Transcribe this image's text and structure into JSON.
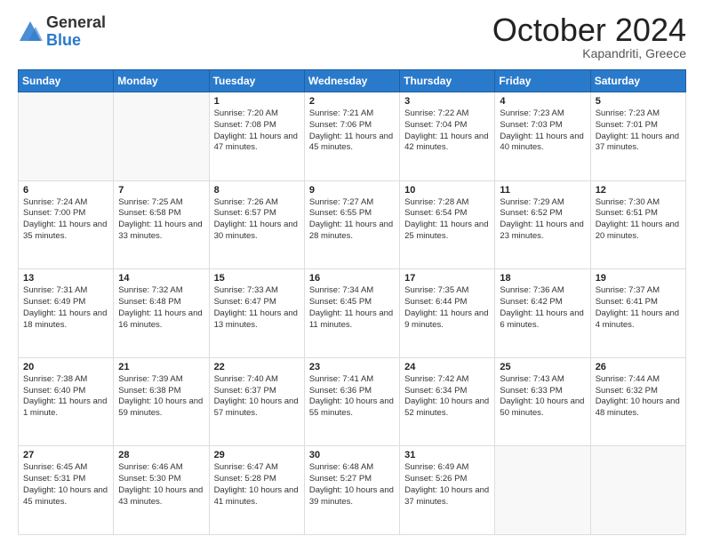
{
  "logo": {
    "general": "General",
    "blue": "Blue"
  },
  "header": {
    "month": "October 2024",
    "location": "Kapandriti, Greece"
  },
  "days_of_week": [
    "Sunday",
    "Monday",
    "Tuesday",
    "Wednesday",
    "Thursday",
    "Friday",
    "Saturday"
  ],
  "weeks": [
    [
      {
        "day": null
      },
      {
        "day": null
      },
      {
        "day": "1",
        "sunrise": "Sunrise: 7:20 AM",
        "sunset": "Sunset: 7:08 PM",
        "daylight": "Daylight: 11 hours and 47 minutes."
      },
      {
        "day": "2",
        "sunrise": "Sunrise: 7:21 AM",
        "sunset": "Sunset: 7:06 PM",
        "daylight": "Daylight: 11 hours and 45 minutes."
      },
      {
        "day": "3",
        "sunrise": "Sunrise: 7:22 AM",
        "sunset": "Sunset: 7:04 PM",
        "daylight": "Daylight: 11 hours and 42 minutes."
      },
      {
        "day": "4",
        "sunrise": "Sunrise: 7:23 AM",
        "sunset": "Sunset: 7:03 PM",
        "daylight": "Daylight: 11 hours and 40 minutes."
      },
      {
        "day": "5",
        "sunrise": "Sunrise: 7:23 AM",
        "sunset": "Sunset: 7:01 PM",
        "daylight": "Daylight: 11 hours and 37 minutes."
      }
    ],
    [
      {
        "day": "6",
        "sunrise": "Sunrise: 7:24 AM",
        "sunset": "Sunset: 7:00 PM",
        "daylight": "Daylight: 11 hours and 35 minutes."
      },
      {
        "day": "7",
        "sunrise": "Sunrise: 7:25 AM",
        "sunset": "Sunset: 6:58 PM",
        "daylight": "Daylight: 11 hours and 33 minutes."
      },
      {
        "day": "8",
        "sunrise": "Sunrise: 7:26 AM",
        "sunset": "Sunset: 6:57 PM",
        "daylight": "Daylight: 11 hours and 30 minutes."
      },
      {
        "day": "9",
        "sunrise": "Sunrise: 7:27 AM",
        "sunset": "Sunset: 6:55 PM",
        "daylight": "Daylight: 11 hours and 28 minutes."
      },
      {
        "day": "10",
        "sunrise": "Sunrise: 7:28 AM",
        "sunset": "Sunset: 6:54 PM",
        "daylight": "Daylight: 11 hours and 25 minutes."
      },
      {
        "day": "11",
        "sunrise": "Sunrise: 7:29 AM",
        "sunset": "Sunset: 6:52 PM",
        "daylight": "Daylight: 11 hours and 23 minutes."
      },
      {
        "day": "12",
        "sunrise": "Sunrise: 7:30 AM",
        "sunset": "Sunset: 6:51 PM",
        "daylight": "Daylight: 11 hours and 20 minutes."
      }
    ],
    [
      {
        "day": "13",
        "sunrise": "Sunrise: 7:31 AM",
        "sunset": "Sunset: 6:49 PM",
        "daylight": "Daylight: 11 hours and 18 minutes."
      },
      {
        "day": "14",
        "sunrise": "Sunrise: 7:32 AM",
        "sunset": "Sunset: 6:48 PM",
        "daylight": "Daylight: 11 hours and 16 minutes."
      },
      {
        "day": "15",
        "sunrise": "Sunrise: 7:33 AM",
        "sunset": "Sunset: 6:47 PM",
        "daylight": "Daylight: 11 hours and 13 minutes."
      },
      {
        "day": "16",
        "sunrise": "Sunrise: 7:34 AM",
        "sunset": "Sunset: 6:45 PM",
        "daylight": "Daylight: 11 hours and 11 minutes."
      },
      {
        "day": "17",
        "sunrise": "Sunrise: 7:35 AM",
        "sunset": "Sunset: 6:44 PM",
        "daylight": "Daylight: 11 hours and 9 minutes."
      },
      {
        "day": "18",
        "sunrise": "Sunrise: 7:36 AM",
        "sunset": "Sunset: 6:42 PM",
        "daylight": "Daylight: 11 hours and 6 minutes."
      },
      {
        "day": "19",
        "sunrise": "Sunrise: 7:37 AM",
        "sunset": "Sunset: 6:41 PM",
        "daylight": "Daylight: 11 hours and 4 minutes."
      }
    ],
    [
      {
        "day": "20",
        "sunrise": "Sunrise: 7:38 AM",
        "sunset": "Sunset: 6:40 PM",
        "daylight": "Daylight: 11 hours and 1 minute."
      },
      {
        "day": "21",
        "sunrise": "Sunrise: 7:39 AM",
        "sunset": "Sunset: 6:38 PM",
        "daylight": "Daylight: 10 hours and 59 minutes."
      },
      {
        "day": "22",
        "sunrise": "Sunrise: 7:40 AM",
        "sunset": "Sunset: 6:37 PM",
        "daylight": "Daylight: 10 hours and 57 minutes."
      },
      {
        "day": "23",
        "sunrise": "Sunrise: 7:41 AM",
        "sunset": "Sunset: 6:36 PM",
        "daylight": "Daylight: 10 hours and 55 minutes."
      },
      {
        "day": "24",
        "sunrise": "Sunrise: 7:42 AM",
        "sunset": "Sunset: 6:34 PM",
        "daylight": "Daylight: 10 hours and 52 minutes."
      },
      {
        "day": "25",
        "sunrise": "Sunrise: 7:43 AM",
        "sunset": "Sunset: 6:33 PM",
        "daylight": "Daylight: 10 hours and 50 minutes."
      },
      {
        "day": "26",
        "sunrise": "Sunrise: 7:44 AM",
        "sunset": "Sunset: 6:32 PM",
        "daylight": "Daylight: 10 hours and 48 minutes."
      }
    ],
    [
      {
        "day": "27",
        "sunrise": "Sunrise: 6:45 AM",
        "sunset": "Sunset: 5:31 PM",
        "daylight": "Daylight: 10 hours and 45 minutes."
      },
      {
        "day": "28",
        "sunrise": "Sunrise: 6:46 AM",
        "sunset": "Sunset: 5:30 PM",
        "daylight": "Daylight: 10 hours and 43 minutes."
      },
      {
        "day": "29",
        "sunrise": "Sunrise: 6:47 AM",
        "sunset": "Sunset: 5:28 PM",
        "daylight": "Daylight: 10 hours and 41 minutes."
      },
      {
        "day": "30",
        "sunrise": "Sunrise: 6:48 AM",
        "sunset": "Sunset: 5:27 PM",
        "daylight": "Daylight: 10 hours and 39 minutes."
      },
      {
        "day": "31",
        "sunrise": "Sunrise: 6:49 AM",
        "sunset": "Sunset: 5:26 PM",
        "daylight": "Daylight: 10 hours and 37 minutes."
      },
      {
        "day": null
      },
      {
        "day": null
      }
    ]
  ]
}
